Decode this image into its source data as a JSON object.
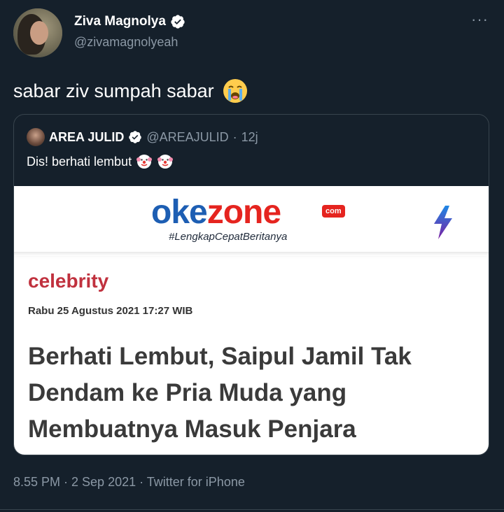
{
  "author": {
    "display_name": "Ziva Magnolya",
    "handle": "@zivamagnolyeah"
  },
  "tweet": {
    "text": "sabar ziv sumpah sabar",
    "emoji": "loudly-crying-face"
  },
  "more_menu": "···",
  "quoted": {
    "display_name": "AREA JULID",
    "handle": "@AREAJULID",
    "separator": "·",
    "time": "12j",
    "text": "Dis! berhati lembut",
    "emoji": "clown-face"
  },
  "article_image": {
    "logo_main": "okezone",
    "logo_com": "com",
    "tagline": "#LengkapCepatBeritanya",
    "category": "celebrity",
    "date": "Rabu 25 Agustus 2021 17:27 WIB",
    "headline": "Berhati Lembut, Saipul Jamil Tak Dendam ke Pria Muda yang Membuatnya Masuk Penjara"
  },
  "footer": {
    "meta": "8.55 PM · 2 Sep 2021 · Twitter for iPhone"
  },
  "colors": {
    "background": "#15202b",
    "text_secondary": "#8b98a5",
    "okezone_blue": "#1d5eb3",
    "okezone_red": "#e5241f"
  }
}
